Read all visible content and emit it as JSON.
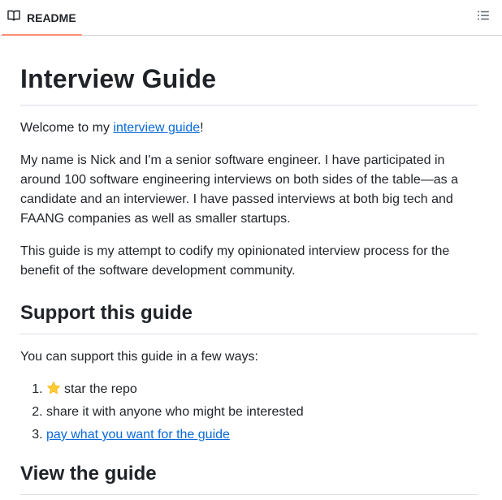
{
  "tab": {
    "label": "README",
    "icon": "book-icon"
  },
  "toc_icon": "list-icon",
  "readme": {
    "title": "Interview Guide",
    "welcome_prefix": "Welcome to my ",
    "welcome_link": "interview guide",
    "welcome_suffix": "!",
    "intro": "My name is Nick and I'm a senior software engineer. I have participated in around 100 software engineering interviews on both sides of the table—as a candidate and an interviewer. I have passed interviews at both big tech and FAANG companies as well as smaller startups.",
    "purpose": "This guide is my attempt to codify my opinionated interview process for the benefit of the software development community.",
    "support_heading": "Support this guide",
    "support_text": "You can support this guide in a few ways:",
    "support_items": [
      {
        "text": "star the repo",
        "icon": "star-icon"
      },
      {
        "text": "share it with anyone who might be interested"
      },
      {
        "link": "pay what you want for the guide"
      }
    ],
    "view_heading": "View the guide"
  },
  "colors": {
    "link": "#0969da",
    "tab_accent": "#fd8c73",
    "text": "#1f2328"
  }
}
